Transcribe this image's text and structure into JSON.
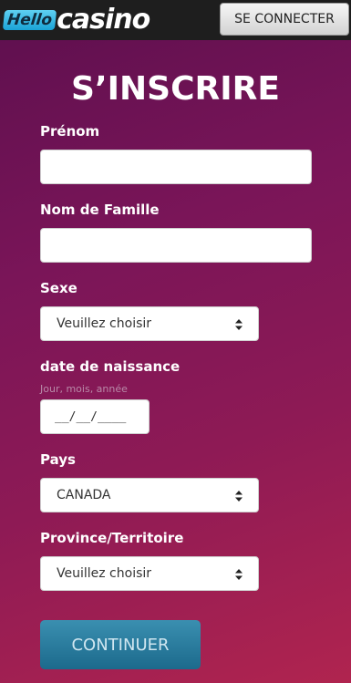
{
  "header": {
    "logo_hello": "Hello",
    "logo_casino": "casino",
    "login_label": "SE CONNECTER"
  },
  "form": {
    "title": "S’INSCRIRE",
    "first_name": {
      "label": "Prénom",
      "value": ""
    },
    "last_name": {
      "label": "Nom de Famille",
      "value": ""
    },
    "gender": {
      "label": "Sexe",
      "value": "Veuillez choisir"
    },
    "birthdate": {
      "label": "date de naissance",
      "hint": "Jour, mois, année",
      "placeholder": "__/__/____"
    },
    "country": {
      "label": "Pays",
      "value": "CANADA"
    },
    "province": {
      "label": "Province/Territoire",
      "value": "Veuillez choisir"
    },
    "continue_label": "CONTINUER"
  },
  "colors": {
    "background_start": "#5c0f4e",
    "background_end": "#b0244f",
    "topbar": "#1e1e1e",
    "logo_accent": "#1aa3d6",
    "continue_button": "#1c6a8c"
  },
  "icons": {
    "select_arrows": "chevron-up-down-icon"
  }
}
